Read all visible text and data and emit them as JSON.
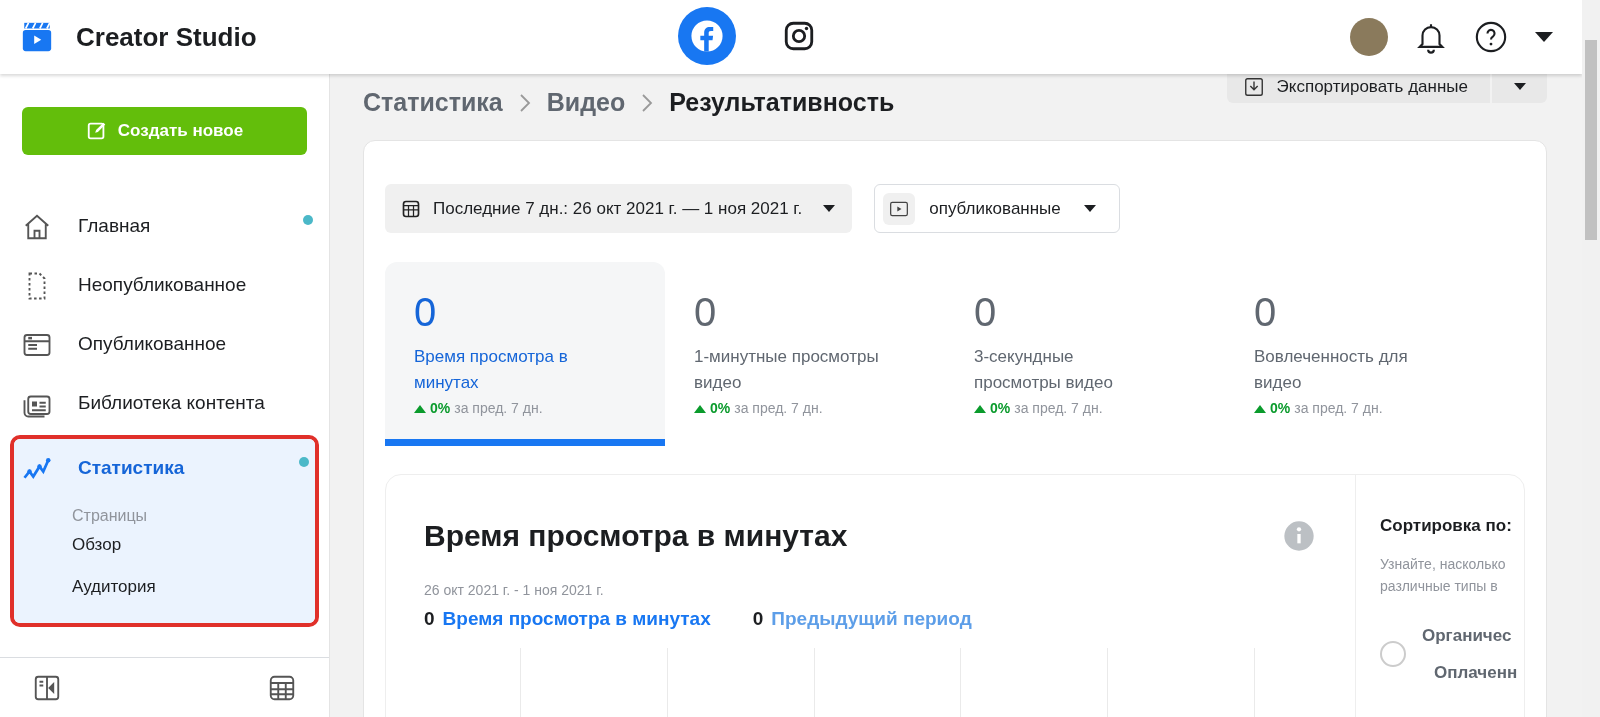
{
  "header": {
    "title": "Creator Studio",
    "platforms": [
      {
        "kind": "facebook",
        "selected": true
      },
      {
        "kind": "instagram",
        "selected": false
      }
    ]
  },
  "sidebar": {
    "create_button": "Создать новое",
    "items": [
      {
        "kind": "home",
        "label": "Главная",
        "selected": false,
        "dot": true,
        "highlighted": false
      },
      {
        "kind": "draft",
        "label": "Неопубликованное",
        "selected": false,
        "dot": false,
        "highlighted": false
      },
      {
        "kind": "published",
        "label": "Опубликованное",
        "selected": false,
        "dot": false,
        "highlighted": false
      },
      {
        "kind": "library",
        "label": "Библиотека контента",
        "selected": false,
        "dot": false,
        "highlighted": false
      },
      {
        "kind": "stats",
        "label": "Статистика",
        "selected": true,
        "dot": true,
        "highlighted": true,
        "section": "Страницы",
        "children": [
          {
            "label": "Обзор"
          },
          {
            "label": "Аудитория"
          }
        ]
      }
    ]
  },
  "main": {
    "breadcrumb": [
      "Статистика",
      "Видео",
      "Результативность"
    ],
    "export_button": "Экспортировать данные",
    "date_filter": "Последние 7 дн.: 26 окт 2021 г. — 1 ноя 2021 г.",
    "status_filter": "опубликованные",
    "metrics": [
      {
        "value": "0",
        "label": "Время просмотра в минутах",
        "change": "0%",
        "period": "за пред. 7 дн.",
        "selected": true
      },
      {
        "value": "0",
        "label": "1-минутные просмотры видео",
        "change": "0%",
        "period": "за пред. 7 дн.",
        "selected": false
      },
      {
        "value": "0",
        "label": "3-секундные просмотры видео",
        "change": "0%",
        "period": "за пред. 7 дн.",
        "selected": false
      },
      {
        "value": "0",
        "label": "Вовлеченность для видео",
        "change": "0%",
        "period": "за пред. 7 дн.",
        "selected": false
      }
    ],
    "chart_panel": {
      "title": "Время просмотра в минутах",
      "date_range": "26 окт 2021 г. - 1 ноя 2021 г.",
      "legend": [
        {
          "value": "0",
          "label": "Время просмотра в минутах",
          "color": "#1877f2"
        },
        {
          "value": "0",
          "label": "Предыдущий период",
          "color": "#5d9ee8"
        }
      ]
    },
    "sort_panel": {
      "title": "Сортировка по:",
      "description": [
        "Узнайте, насколько",
        "различные типы в"
      ],
      "option": {
        "label": "Органичес",
        "sublabel": "Оплаченн",
        "selected": false
      }
    }
  }
}
